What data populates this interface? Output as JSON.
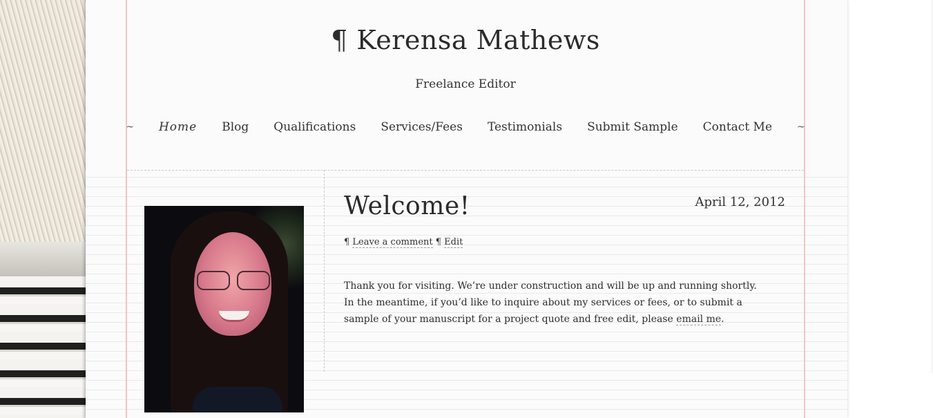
{
  "site": {
    "title": "¶ Kerensa Mathews",
    "description": "Freelance Editor"
  },
  "nav": {
    "left_tilde": "~",
    "right_tilde": "~",
    "items": [
      {
        "label": "Home",
        "current": true
      },
      {
        "label": "Blog"
      },
      {
        "label": "Qualifications"
      },
      {
        "label": "Services/Fees"
      },
      {
        "label": "Testimonials"
      },
      {
        "label": "Submit Sample"
      },
      {
        "label": "Contact Me"
      }
    ]
  },
  "post": {
    "title": "Welcome!",
    "date": "April 12, 2012",
    "meta": {
      "pilcrow_1": "¶",
      "comment_link": "Leave a comment",
      "pilcrow_2": "¶",
      "edit_link": "Edit"
    },
    "body_text": "Thank you for visiting. We’re under construction and will be up and running shortly. In the meantime, if you’d like to inquire about my services or fees, or to submit a sample of your manuscript for a project quote and free edit, please ",
    "body_link": "email me",
    "body_end": "."
  },
  "sidebar": {
    "photo_alt": "Portrait photo"
  },
  "colors": {
    "margin_line": "#f2c4c2",
    "ruled_line": "#e6e9ef",
    "paper": "#fbfbfb",
    "text": "#2e2e2e"
  }
}
